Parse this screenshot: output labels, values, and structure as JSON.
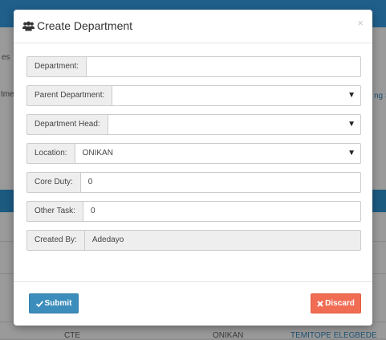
{
  "background": {
    "fragments": [
      "es",
      "tme",
      "ng S",
      "CTE",
      "ONIKAN",
      "TEMITOPE ELEGBEDE"
    ]
  },
  "modal": {
    "title": "Create Department",
    "close_glyph": "×",
    "icon": "users-icon"
  },
  "form": {
    "department": {
      "label": "Department:",
      "value": ""
    },
    "parent_department": {
      "label": "Parent Department:",
      "value": ""
    },
    "department_head": {
      "label": "Department Head:",
      "value": ""
    },
    "location": {
      "label": "Location:",
      "value": "ONIKAN"
    },
    "core_duty": {
      "label": "Core Duty:",
      "value": "0"
    },
    "other_task": {
      "label": "Other Task:",
      "value": "0"
    },
    "created_by": {
      "label": "Created By:",
      "value": "Adedayo"
    }
  },
  "buttons": {
    "submit": {
      "label": "Submit",
      "icon": "check-icon",
      "color": "#3c8dbc"
    },
    "discard": {
      "label": "Discard",
      "icon": "times-icon",
      "color": "#f06d54"
    }
  }
}
